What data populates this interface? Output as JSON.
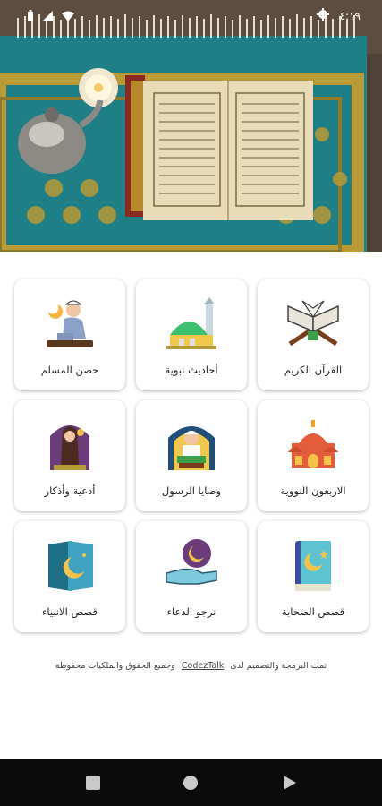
{
  "status": {
    "time": "٤:١٩"
  },
  "colors": {
    "rug_teal": "#1f7f86",
    "rug_gold": "#b99a35",
    "book_page": "#e9dbb7",
    "nav_bg": "#0b0b0b"
  },
  "cards": [
    {
      "label": "القرآن الكريم",
      "icon": "quran-book-icon"
    },
    {
      "label": "أحاديث نبوية",
      "icon": "mosque-icon"
    },
    {
      "label": "حصن المسلم",
      "icon": "praying-man-icon"
    },
    {
      "label": "الاربعون النووية",
      "icon": "domes-mosque-icon"
    },
    {
      "label": "وصايا الرسول",
      "icon": "reading-imam-icon"
    },
    {
      "label": "أدعية وأذكار",
      "icon": "praying-woman-icon"
    },
    {
      "label": "قصص الصحابة",
      "icon": "crescent-book-icon"
    },
    {
      "label": "نرجو الدعاء",
      "icon": "hand-crescent-icon"
    },
    {
      "label": "قصص الانبياء",
      "icon": "crescent-card-icon"
    }
  ],
  "footer": {
    "prefix": "تمت البرمجة والتصميم لدى",
    "link": "CodezTalk",
    "suffix": "وجميع الحقوق والملكيات محفوظة"
  }
}
